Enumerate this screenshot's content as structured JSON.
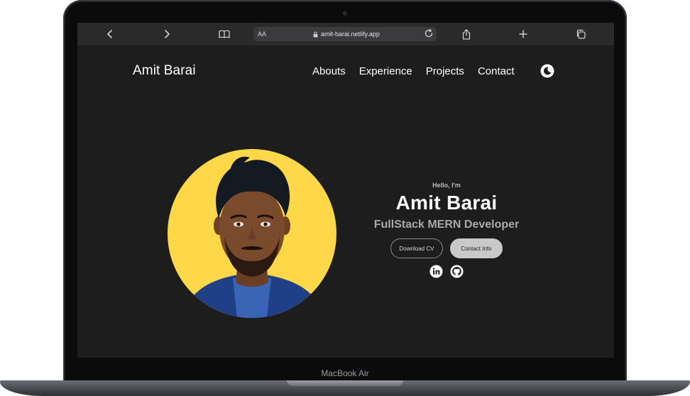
{
  "device": {
    "label": "MacBook Air"
  },
  "browser": {
    "aa_label": "AA",
    "url": "amit-barai.netlify.app"
  },
  "site": {
    "brand": "Amit Barai",
    "nav": [
      "Abouts",
      "Experience",
      "Projects",
      "Contact"
    ],
    "hero": {
      "greeting": "Hello, I'm",
      "name": "Amit Barai",
      "role": "FullStack MERN Developer",
      "download_cv": "Download CV",
      "contact_info": "Contact Info"
    }
  },
  "colors": {
    "page_bg": "#1d1d1d",
    "photo_bg": "#ffd84a",
    "text_primary": "#ffffff",
    "text_muted": "#a9a9a9"
  },
  "icons": {
    "back": "chevron-left-icon",
    "forward": "chevron-right-icon",
    "reader": "book-icon",
    "lock": "lock-icon",
    "reload": "reload-icon",
    "share": "share-icon",
    "new_tab": "plus-icon",
    "tabs": "tabs-icon",
    "theme": "moon-icon",
    "linkedin": "linkedin-icon",
    "github": "github-icon"
  }
}
